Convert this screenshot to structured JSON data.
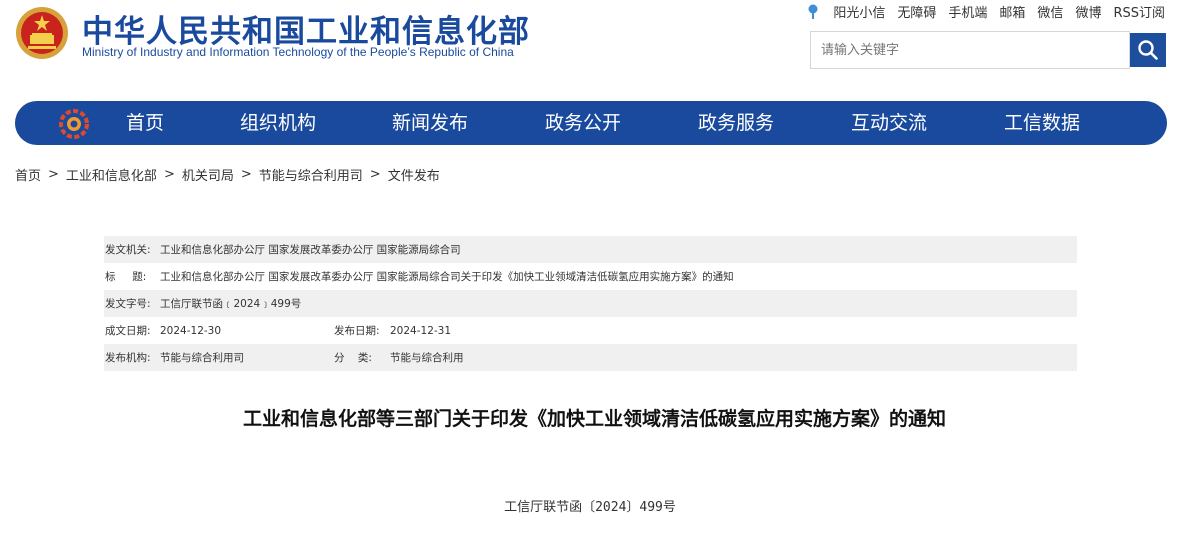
{
  "header": {
    "title_cn": "中华人民共和国工业和信息化部",
    "title_en": "Ministry of Industry and Information Technology of the People’s Republic of China",
    "top_links": [
      "阳光小信",
      "无障碍",
      "手机端",
      "邮箱",
      "微信",
      "微博",
      "RSS订阅"
    ],
    "search_placeholder": "请输入关键字",
    "brand_color": "#1a4a9e"
  },
  "nav": {
    "items": [
      "首页",
      "组织机构",
      "新闻发布",
      "政务公开",
      "政务服务",
      "互动交流",
      "工信数据"
    ]
  },
  "breadcrumb": [
    "首页",
    "工业和信息化部",
    "机关司局",
    "节能与综合利用司",
    "文件发布"
  ],
  "meta": {
    "issuer_label": "发文机关:",
    "issuer": "工业和信息化部办公厅 国家发展改革委办公厅 国家能源局综合司",
    "title_label": "标     题:",
    "title": "工业和信息化部办公厅 国家发展改革委办公厅 国家能源局综合司关于印发《加快工业领域清洁低碳氢应用实施方案》的通知",
    "docno_label": "发文字号:",
    "docno": "工信厅联节函﹝2024﹞499号",
    "created_label": "成文日期:",
    "created": "2024-12-30",
    "published_label": "发布日期:",
    "published": "2024-12-31",
    "org_label": "发布机构:",
    "org": "节能与综合利用司",
    "category_label": "分    类:",
    "category": "节能与综合利用"
  },
  "document": {
    "title": "工业和信息化部等三部门关于印发《加快工业领域清洁低碳氢应用实施方案》的通知",
    "number": "工信厅联节函〔2024〕499号"
  }
}
